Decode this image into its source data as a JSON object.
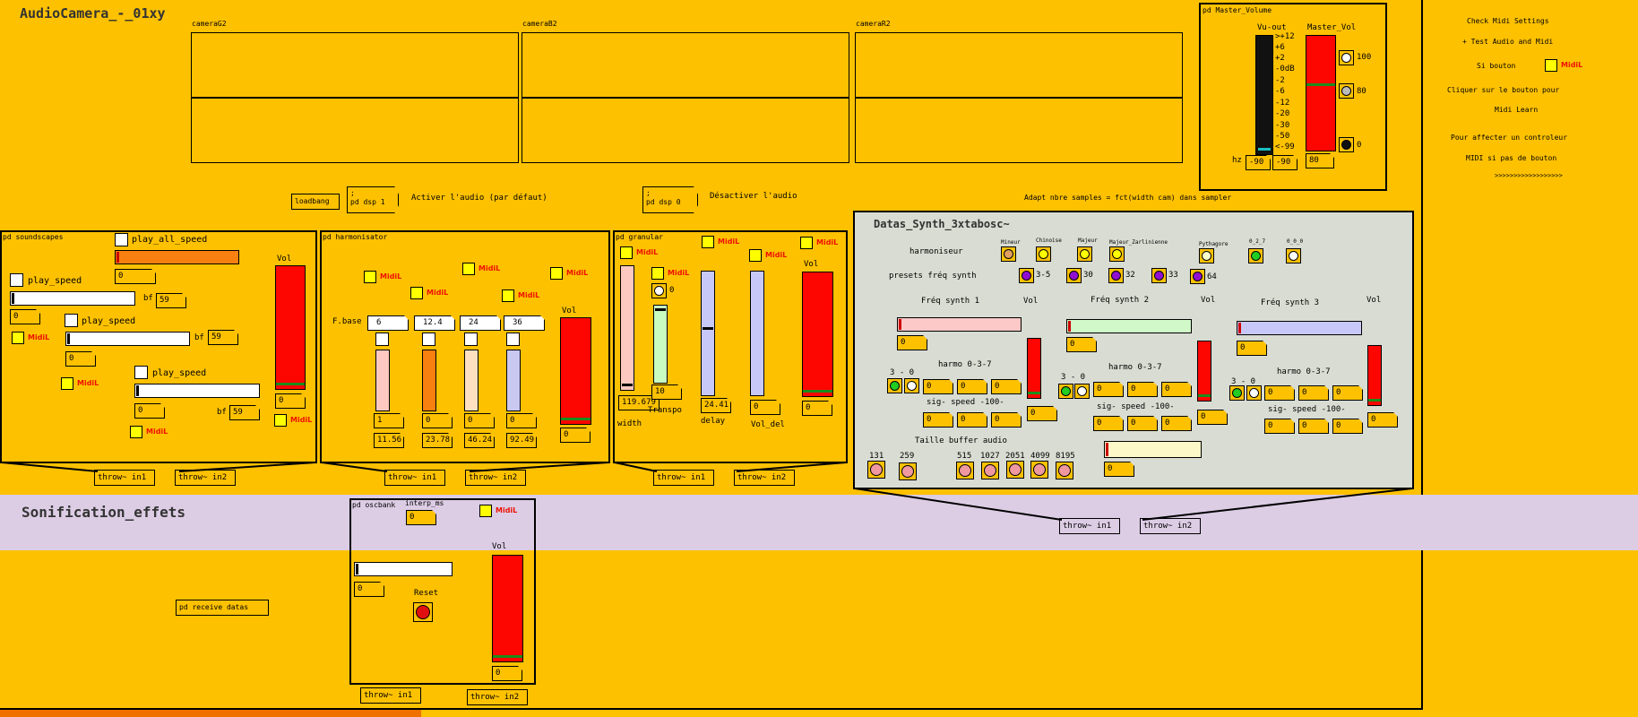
{
  "patch_title": "AudioCamera_-_01xy",
  "sonif_title": "Sonification_effets",
  "cameras": [
    "cameraG2",
    "cameraB2",
    "cameraR2"
  ],
  "loadbang": "loadbang",
  "dsp1": ";\npd dsp 1",
  "dsp1_label": "Activer l'audio (par défaut)",
  "dsp0": ";\npd dsp 0",
  "dsp0_label": "Désactiver l'audio",
  "adapt_label": "Adapt nbre samples = fct(width cam) dans sampler",
  "master": {
    "title": "pd Master_Volume",
    "vu_label": "Vu-out",
    "vol_label": "Master_Vol",
    "scale": [
      ">+12",
      "+6",
      "+2",
      "-0dB",
      "-2",
      "-6",
      "-12",
      "-20",
      "-30",
      "-50",
      "<-99"
    ],
    "hz": "hz",
    "hz1": "-90",
    "hz2": "-90",
    "vol_num": "80",
    "presets": [
      "100",
      "80",
      "0"
    ]
  },
  "help": [
    "Check Midi Settings",
    "+ Test Audio and Midi",
    "Si bouton",
    "Cliquer sur le bouton pour",
    "Midi Learn",
    "Pour affecter un controleur",
    "MIDI si pas de bouton",
    ">>>>>>>>>>>>>>>>>>"
  ],
  "midi": "MidiL",
  "soundscapes": {
    "title": "pd soundscapes",
    "play_all": "play_all_speed",
    "play": "play_speed",
    "bf": "bf",
    "bf_vals": [
      "59",
      "59",
      "59"
    ],
    "zero": "0",
    "vol": "Vol"
  },
  "harmonisator": {
    "title": "pd harmonisator",
    "fbase": "F.base",
    "fvals": [
      "6",
      "12.4",
      "24",
      "36"
    ],
    "low": [
      "1",
      "0",
      "0",
      "0"
    ],
    "res": [
      "11.56",
      "23.78",
      "46.24",
      "92.49"
    ],
    "vol": "Vol",
    "vol_num": "0"
  },
  "granular": {
    "title": "pd granular",
    "width_num": "119.679",
    "width": "width",
    "transpo_num": "10",
    "transpo": "Transpo",
    "delay_num": "24.41",
    "delay": "delay",
    "voldel_num": "0",
    "voldel": "Vol_del",
    "vol": "Vol",
    "vol_num": "0",
    "zero": "0"
  },
  "synth": {
    "title": "Datas_Synth_3xtabosc~",
    "harmoniseur": "harmoniseur",
    "presets_label": "presets fréq synth",
    "scales": [
      "Mineur",
      "Chinoise",
      "Majeur",
      "Majeur_Zarlinienne",
      "Pythagore",
      "0_2_7",
      "0_0_0"
    ],
    "presets": [
      "3-5",
      "30",
      "32",
      "33",
      "64"
    ],
    "freq": [
      "Fréq synth 1",
      "Fréq synth 2",
      "Fréq synth 3"
    ],
    "vol": "Vol",
    "harmo": "harmo 0-3-7",
    "three": "3 - 0",
    "sig": "sig- speed -100-",
    "taille": "Taille buffer audio",
    "buffers": [
      "131",
      "259",
      "515",
      "1027",
      "2051",
      "4099",
      "8195"
    ],
    "zero": "0"
  },
  "throws": {
    "in1": "throw~ in1",
    "in2": "throw~ in2"
  },
  "oscbank": {
    "title": "pd oscbank",
    "interp": "interp_ms",
    "zero": "0",
    "reset": "Reset",
    "vol": "Vol"
  },
  "receive": "pd receive datas"
}
